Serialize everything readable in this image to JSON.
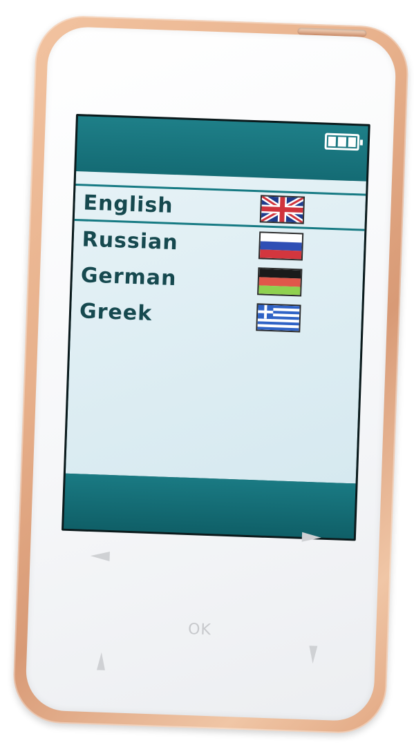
{
  "device": {
    "frame_color": "#e7b08b",
    "face_color": "#f6f7f9"
  },
  "screen": {
    "status_bar": {
      "battery_icon": "battery-full-icon",
      "battery_level": 1.0
    },
    "accent_color": "#167a83",
    "languages": [
      {
        "label": "English",
        "flag_icon": "uk-flag-icon",
        "selected": true
      },
      {
        "label": "Russian",
        "flag_icon": "russia-flag-icon",
        "selected": false
      },
      {
        "label": "German",
        "flag_icon": "germany-flag-icon",
        "selected": false
      },
      {
        "label": "Greek",
        "flag_icon": "greece-flag-icon",
        "selected": false
      }
    ]
  },
  "buttons": {
    "ok_label": "OK",
    "left_icon": "arrow-left-icon",
    "right_icon": "arrow-right-icon",
    "up_icon": "arrow-up-icon",
    "down_icon": "arrow-down-icon"
  }
}
